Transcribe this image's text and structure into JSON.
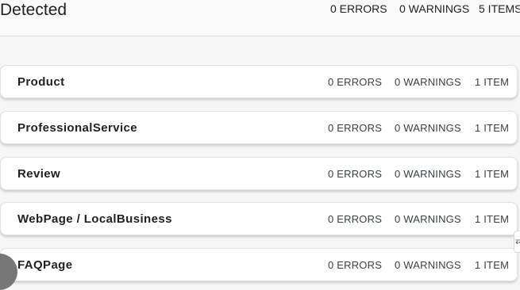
{
  "header": {
    "title": "Detected",
    "errors": "0 ERRORS",
    "warnings": "0 WARNINGS",
    "items": "5 ITEMS"
  },
  "rows": [
    {
      "name": "Product",
      "errors": "0 ERRORS",
      "warnings": "0 WARNINGS",
      "items": "1 ITEM"
    },
    {
      "name": "ProfessionalService",
      "errors": "0 ERRORS",
      "warnings": "0 WARNINGS",
      "items": "1 ITEM"
    },
    {
      "name": "Review",
      "errors": "0 ERRORS",
      "warnings": "0 WARNINGS",
      "items": "1 ITEM"
    },
    {
      "name": "WebPage / LocalBusiness",
      "errors": "0 ERRORS",
      "warnings": "0 WARNINGS",
      "items": "1 ITEM"
    },
    {
      "name": "FAQPage",
      "errors": "0 ERRORS",
      "warnings": "0 WARNINGS",
      "items": "1 ITEM"
    }
  ],
  "icons": {
    "side_handle": "expand-icon",
    "avatar": "avatar"
  }
}
